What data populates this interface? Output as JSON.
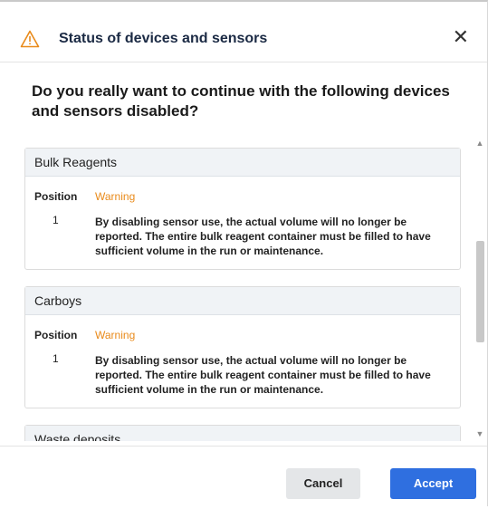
{
  "dialog": {
    "title": "Status of devices and sensors",
    "close_label": "✕",
    "question": "Do you really want to continue with the following devices and sensors disabled?"
  },
  "panels": [
    {
      "title": "Bulk Reagents",
      "position_label": "Position",
      "status": "Warning",
      "position": "1",
      "message": "By disabling sensor use, the actual volume will no longer be reported. The entire bulk reagent container must be filled to have sufficient volume in the run or maintenance."
    },
    {
      "title": "Carboys",
      "position_label": "Position",
      "status": "Warning",
      "position": "1",
      "message": "By disabling sensor use, the actual volume will no longer be reported. The entire bulk reagent container must be filled to have sufficient volume in the run or maintenance."
    },
    {
      "title": "Waste deposits"
    }
  ],
  "buttons": {
    "cancel": "Cancel",
    "accept": "Accept"
  },
  "colors": {
    "warning": "#e98a1a",
    "accent": "#2f6fe0",
    "title": "#1b2a44"
  },
  "icons": {
    "header": "warning-triangle-icon",
    "close": "close-icon"
  }
}
